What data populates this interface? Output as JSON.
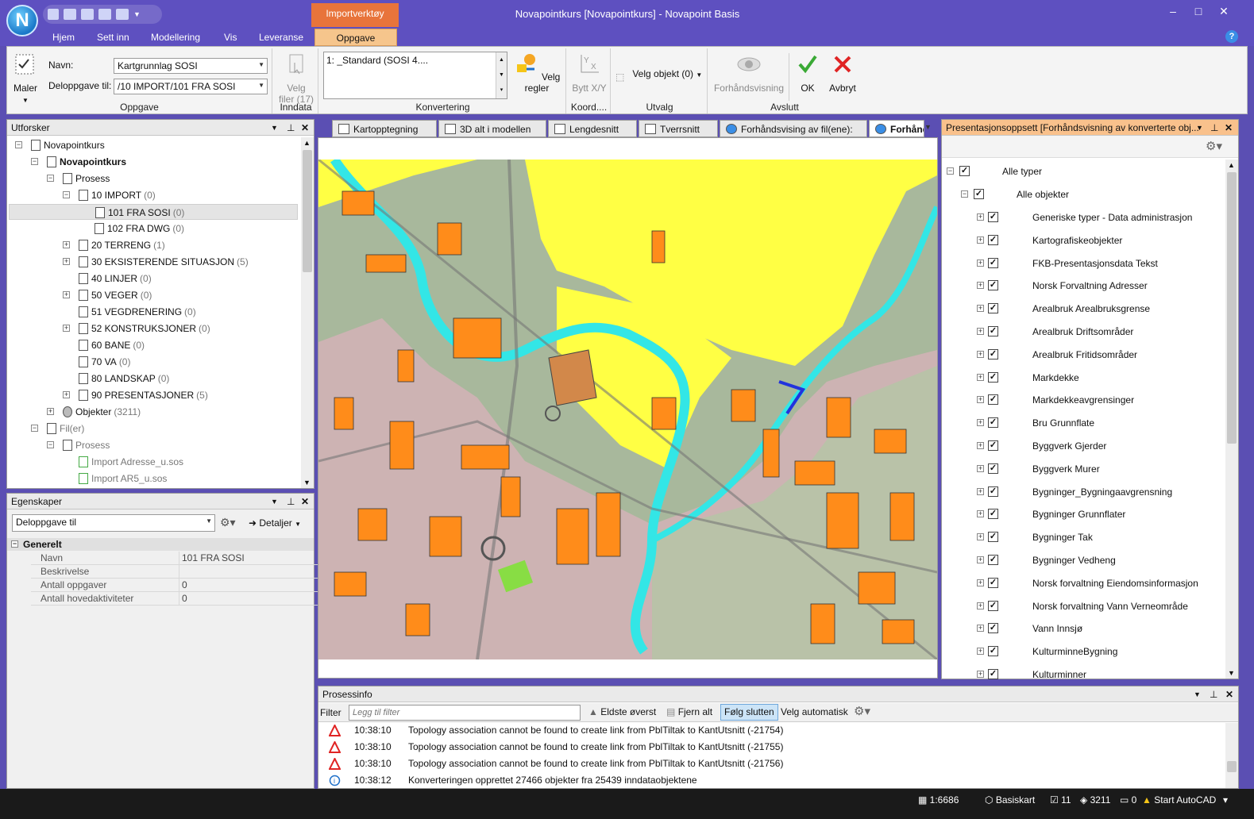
{
  "window": {
    "title": "Novapointkurs [Novapointkurs] - Novapoint Basis",
    "logo_letter": "N",
    "contextual_tab_group": "Importverktøy",
    "controls": [
      "–",
      "□",
      "✕"
    ]
  },
  "menu": {
    "items": [
      "Hjem",
      "Sett inn",
      "Modellering",
      "Vis",
      "Leveranse"
    ],
    "active": "Oppgave"
  },
  "ribbon": {
    "oppgave": {
      "maler_label": "Maler",
      "navn_label": "Navn:",
      "navn_value": "Kartgrunnlag SOSI",
      "deloppgave_label": "Deloppgave til:",
      "deloppgave_value": "/10 IMPORT/101 FRA SOSI",
      "group_label": "Oppgave"
    },
    "inndata": {
      "velg_filer": "Velg",
      "velg_filer_line2": "filer (17)",
      "group_label": "Inndata"
    },
    "konvertering": {
      "list_value": "1: _Standard (SOSI 4....",
      "velg_regler": "Velg regler",
      "group_label": "Konvertering"
    },
    "koord": {
      "bytt": "Bytt X/Y",
      "group_label": "Koord...."
    },
    "utvalg": {
      "velg_objekt": "Velg objekt (0)",
      "group_label": "Utvalg"
    },
    "avslutt": {
      "forhandsvisning": "Forhåndsvisning",
      "ok": "OK",
      "avbryt": "Avbryt",
      "group_label": "Avslutt"
    }
  },
  "explorer": {
    "title": "Utforsker",
    "rows": [
      {
        "label": "Novapointkurs",
        "count": "",
        "bold": false
      },
      {
        "label": "Novapointkurs",
        "count": "",
        "bold": true
      },
      {
        "label": "Prosess",
        "count": "",
        "bold": false
      },
      {
        "label": "10 IMPORT",
        "count": "(0)",
        "bold": false
      },
      {
        "label": "101 FRA SOSI",
        "count": "(0)",
        "bold": false
      },
      {
        "label": "102 FRA DWG",
        "count": "(0)",
        "bold": false
      },
      {
        "label": "20 TERRENG",
        "count": "(1)",
        "bold": false
      },
      {
        "label": "30 EKSISTERENDE SITUASJON",
        "count": "(5)",
        "bold": false
      },
      {
        "label": "40 LINJER",
        "count": "(0)",
        "bold": false
      },
      {
        "label": "50 VEGER",
        "count": "(0)",
        "bold": false
      },
      {
        "label": "51 VEGDRENERING",
        "count": "(0)",
        "bold": false
      },
      {
        "label": "52 KONSTRUKSJONER",
        "count": "(0)",
        "bold": false
      },
      {
        "label": "60 BANE",
        "count": "(0)",
        "bold": false
      },
      {
        "label": "70 VA",
        "count": "(0)",
        "bold": false
      },
      {
        "label": "80 LANDSKAP",
        "count": "(0)",
        "bold": false
      },
      {
        "label": "90 PRESENTASJONER",
        "count": "(5)",
        "bold": false
      },
      {
        "label": "Objekter",
        "count": "(3211)",
        "bold": false
      },
      {
        "label": "Fil(er)",
        "count": "",
        "bold": false
      },
      {
        "label": "Prosess",
        "count": "",
        "bold": false
      },
      {
        "label": "Import Adresse_u.sos",
        "count": "",
        "bold": false
      },
      {
        "label": "Import AR5_u.sos",
        "count": "",
        "bold": false
      }
    ]
  },
  "properties": {
    "title": "Egenskaper",
    "selector": "Deloppgave til",
    "detaljer": "Detaljer",
    "section": "Generelt",
    "rows": [
      {
        "key": "Navn",
        "value": "101 FRA SOSI"
      },
      {
        "key": "Beskrivelse",
        "value": ""
      },
      {
        "key": "Antall oppgaver",
        "value": "0"
      },
      {
        "key": "Antall hovedaktiviteter",
        "value": "0"
      }
    ]
  },
  "doc_tabs": [
    "Kartopptegning",
    "3D alt i modellen",
    "Lengdesnitt",
    "Tverrsnitt",
    "Forhåndsvising av fil(ene):",
    "Forhånd"
  ],
  "presentation": {
    "title": "Presentasjonsoppsett [Forhåndsvisning av konverterte obj...",
    "root": "Alle typer",
    "sub": "Alle objekter",
    "items": [
      "Generiske typer - Data administrasjon",
      "Kartografiskeobjekter",
      "FKB-Presentasjonsdata Tekst",
      "Norsk Forvaltning Adresser",
      "Arealbruk Arealbruksgrense",
      "Arealbruk Driftsområder",
      "Arealbruk Fritidsområder",
      "Markdekke",
      "Markdekkeavgrensinger",
      "Bru Grunnflate",
      "Byggverk Gjerder",
      "Byggverk Murer",
      "Bygninger_Bygningaavgrensning",
      "Bygninger Grunnflater",
      "Bygninger Tak",
      "Bygninger Vedheng",
      "Norsk forvaltning Eiendomsinformasjon",
      "Norsk forvaltning Vann Verneområde",
      "Vann Innsjø",
      "KulturminneBygning",
      "Kulturminner"
    ]
  },
  "processinfo": {
    "title": "Prosessinfo",
    "filter_label": "Filter",
    "filter_placeholder": "Legg til filter",
    "btn_eldste": "Eldste øverst",
    "btn_fjern": "Fjern alt",
    "btn_folg": "Følg slutten",
    "btn_velg": "Velg automatisk",
    "rows": [
      {
        "type": "warning",
        "time": "10:38:10",
        "msg": "Topology association cannot be found to create link from PblTiltak to KantUtsnitt (-21754)"
      },
      {
        "type": "warning",
        "time": "10:38:10",
        "msg": "Topology association cannot be found to create link from PblTiltak to KantUtsnitt (-21755)"
      },
      {
        "type": "warning",
        "time": "10:38:10",
        "msg": "Topology association cannot be found to create link from PblTiltak to KantUtsnitt (-21756)"
      },
      {
        "type": "info",
        "time": "10:38:12",
        "msg": "Konverteringen opprettet 27466 objekter fra 25439 inndataobjektene"
      }
    ]
  },
  "statusbar": {
    "scale": "1:6686",
    "basiskart": "Basiskart",
    "count1": "11",
    "count2": "3211",
    "count3": "0",
    "autocad": "Start AutoCAD"
  },
  "colors": {
    "title_bar": "#5e50c0",
    "context_orange": "#e8743b",
    "map_yellow": "#ffff44",
    "map_building": "#ff8c1a",
    "map_water": "#33e6e6"
  },
  "icons": [
    "home-icon",
    "gear-icon",
    "eye-icon",
    "check-icon",
    "cross-icon",
    "warning-icon",
    "info-icon",
    "pin-icon",
    "close-icon"
  ]
}
